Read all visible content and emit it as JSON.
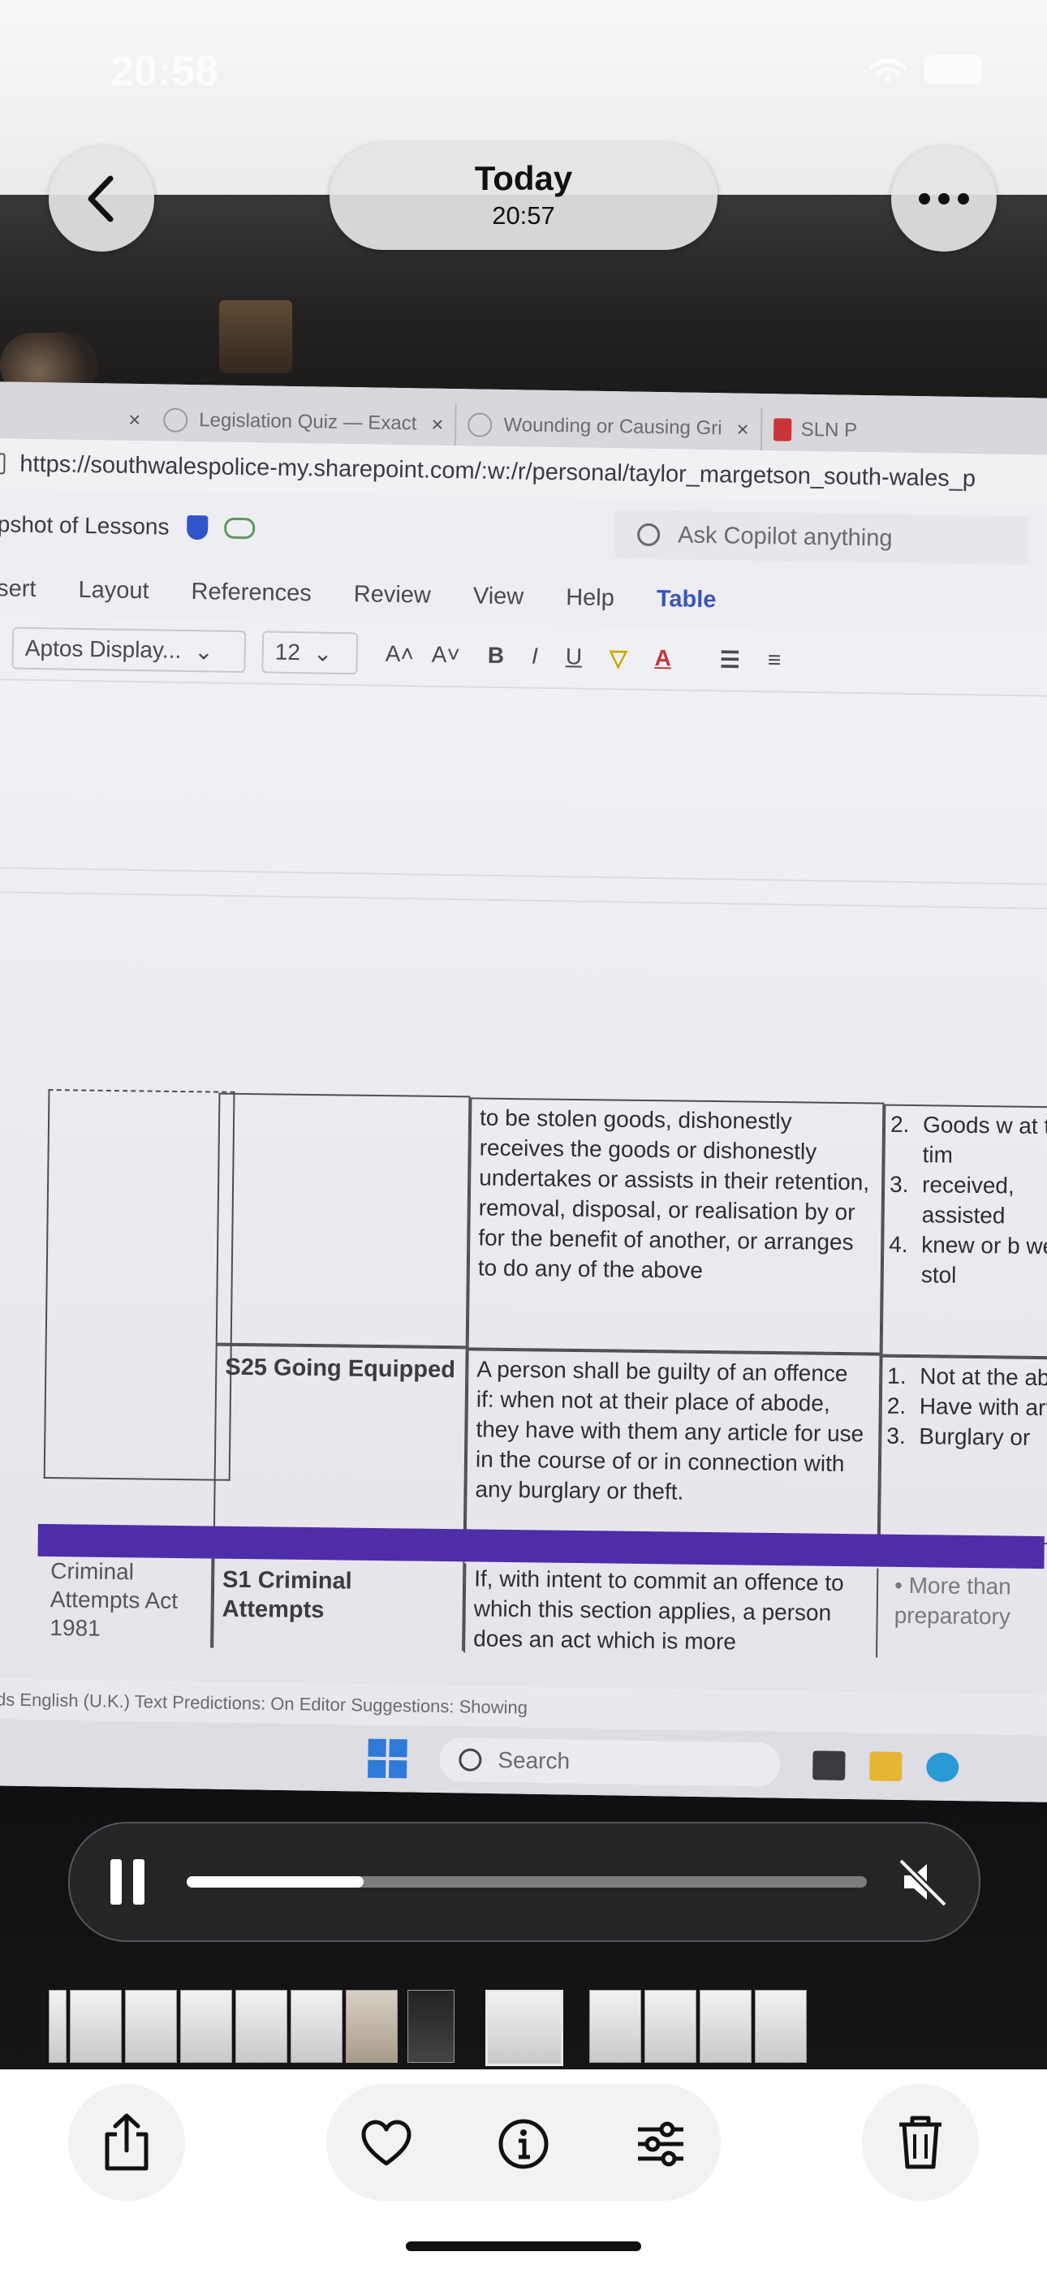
{
  "status_bar": {
    "time": "20:58"
  },
  "header": {
    "date_title": "Today",
    "date_time": "20:57"
  },
  "browser": {
    "tabs": [
      {
        "label": "Legislation Quiz — Exact"
      },
      {
        "label": "Wounding or Causing Gri"
      },
      {
        "label": "SLN P"
      }
    ],
    "url": "https://southwalespolice-my.sharepoint.com/:w:/r/personal/taylor_margetson_south-wales_p"
  },
  "word": {
    "doc_title": "apshot of Lessons",
    "copilot_placeholder": "Ask Copilot anything",
    "menu": [
      "nsert",
      "Layout",
      "References",
      "Review",
      "View",
      "Help",
      "Table"
    ],
    "font_name": "Aptos Display...",
    "font_size": "12",
    "table": {
      "row1_text_parts": [
        "to be stolen goods, dishonestly receives the goods or dishonestly undertakes or assists in their retention, removal, disposal, or realisation by or for the benefit of another, or arranges to do any of the above"
      ],
      "row1_points": [
        {
          "num": "2.",
          "text": "Goods w at the tim"
        },
        {
          "num": "3.",
          "text": "received, assisted"
        },
        {
          "num": "4.",
          "text": "knew or b were stol"
        }
      ],
      "row2_heading": "S25 Going Equipped",
      "row2_text": "A person shall be guilty of an offence if: when not at their place of abode, they have with them any article for use in the course of or in connection with any burglary or theft.",
      "row2_points": [
        {
          "num": "1.",
          "text": "Not at the abode"
        },
        {
          "num": "2.",
          "text": "Have with article"
        },
        {
          "num": "3.",
          "text": "Burglary or"
        }
      ],
      "row3_act": "Criminal Attempts Act 1981",
      "row3_heading": "S1 Criminal Attempts",
      "row3_text": "If, with intent to commit an offence to which this section applies, a person does an act which is more",
      "row3_point": "More than preparatory"
    },
    "statusbar_text": "vords   English (U.K.)   Text Predictions: On   Editor Suggestions: Showing",
    "taskbar_search": "Search"
  },
  "player": {
    "progress_percent": 26,
    "muted": true
  },
  "colors": {
    "table_band": "#4e2ea8",
    "menu_active": "#3d55b8"
  }
}
